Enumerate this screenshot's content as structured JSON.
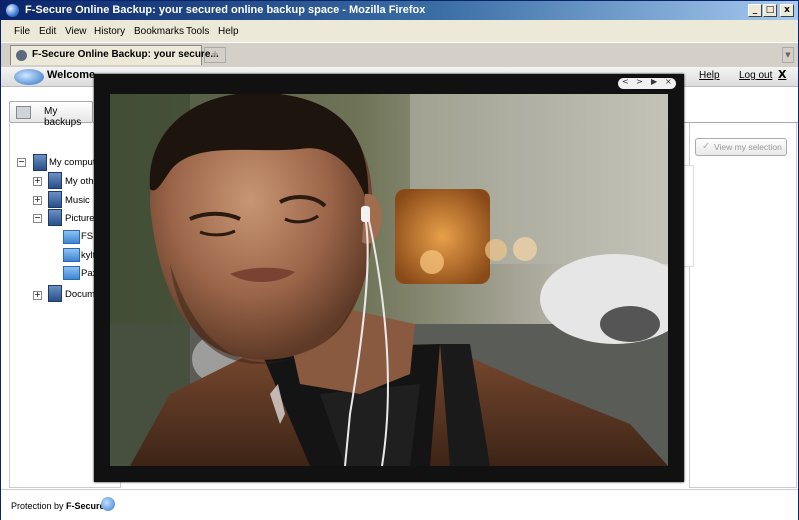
{
  "window": {
    "title": "F-Secure Online Backup: your secured online backup space - Mozilla Firefox",
    "controls": {
      "minimize": "_",
      "maximize": "□",
      "close": "x"
    }
  },
  "menu": [
    "File",
    "Edit",
    "View",
    "History",
    "Bookmarks",
    "Tools",
    "Help"
  ],
  "browser_tab": {
    "title": "F-Secure Online Backup: your secure...",
    "new_tab": "+"
  },
  "header": {
    "welcome": "Welcome",
    "help": "Help",
    "logout": "Log out",
    "close": "X"
  },
  "my_backups_tab": "My backups",
  "view_selection_button": {
    "check": "✓",
    "label": "View my selection"
  },
  "tree": {
    "root": "My compute",
    "items": [
      {
        "label": "My othe",
        "toggle": "+"
      },
      {
        "label": "Music",
        "toggle": "+"
      },
      {
        "label": "Pictures",
        "toggle": "−"
      },
      {
        "label": "FSI",
        "toggle": ""
      },
      {
        "label": "kylt",
        "toggle": ""
      },
      {
        "label": "Pax",
        "toggle": ""
      },
      {
        "label": "Docume",
        "toggle": "+"
      }
    ],
    "root_toggle": "−"
  },
  "lightbox": {
    "controls": {
      "prev": "<",
      "next": ">",
      "play": "▶",
      "close": "×"
    },
    "photo_description": ""
  },
  "footer": {
    "protection_by": "Protection by",
    "brand": "F-Secure."
  },
  "colors": {
    "title_bar_start": "#0a246a",
    "title_bar_end": "#a6caf0",
    "chrome": "#ece9d8",
    "lightbox_frame": "#111111",
    "folder_blue": "#3c86d4"
  }
}
